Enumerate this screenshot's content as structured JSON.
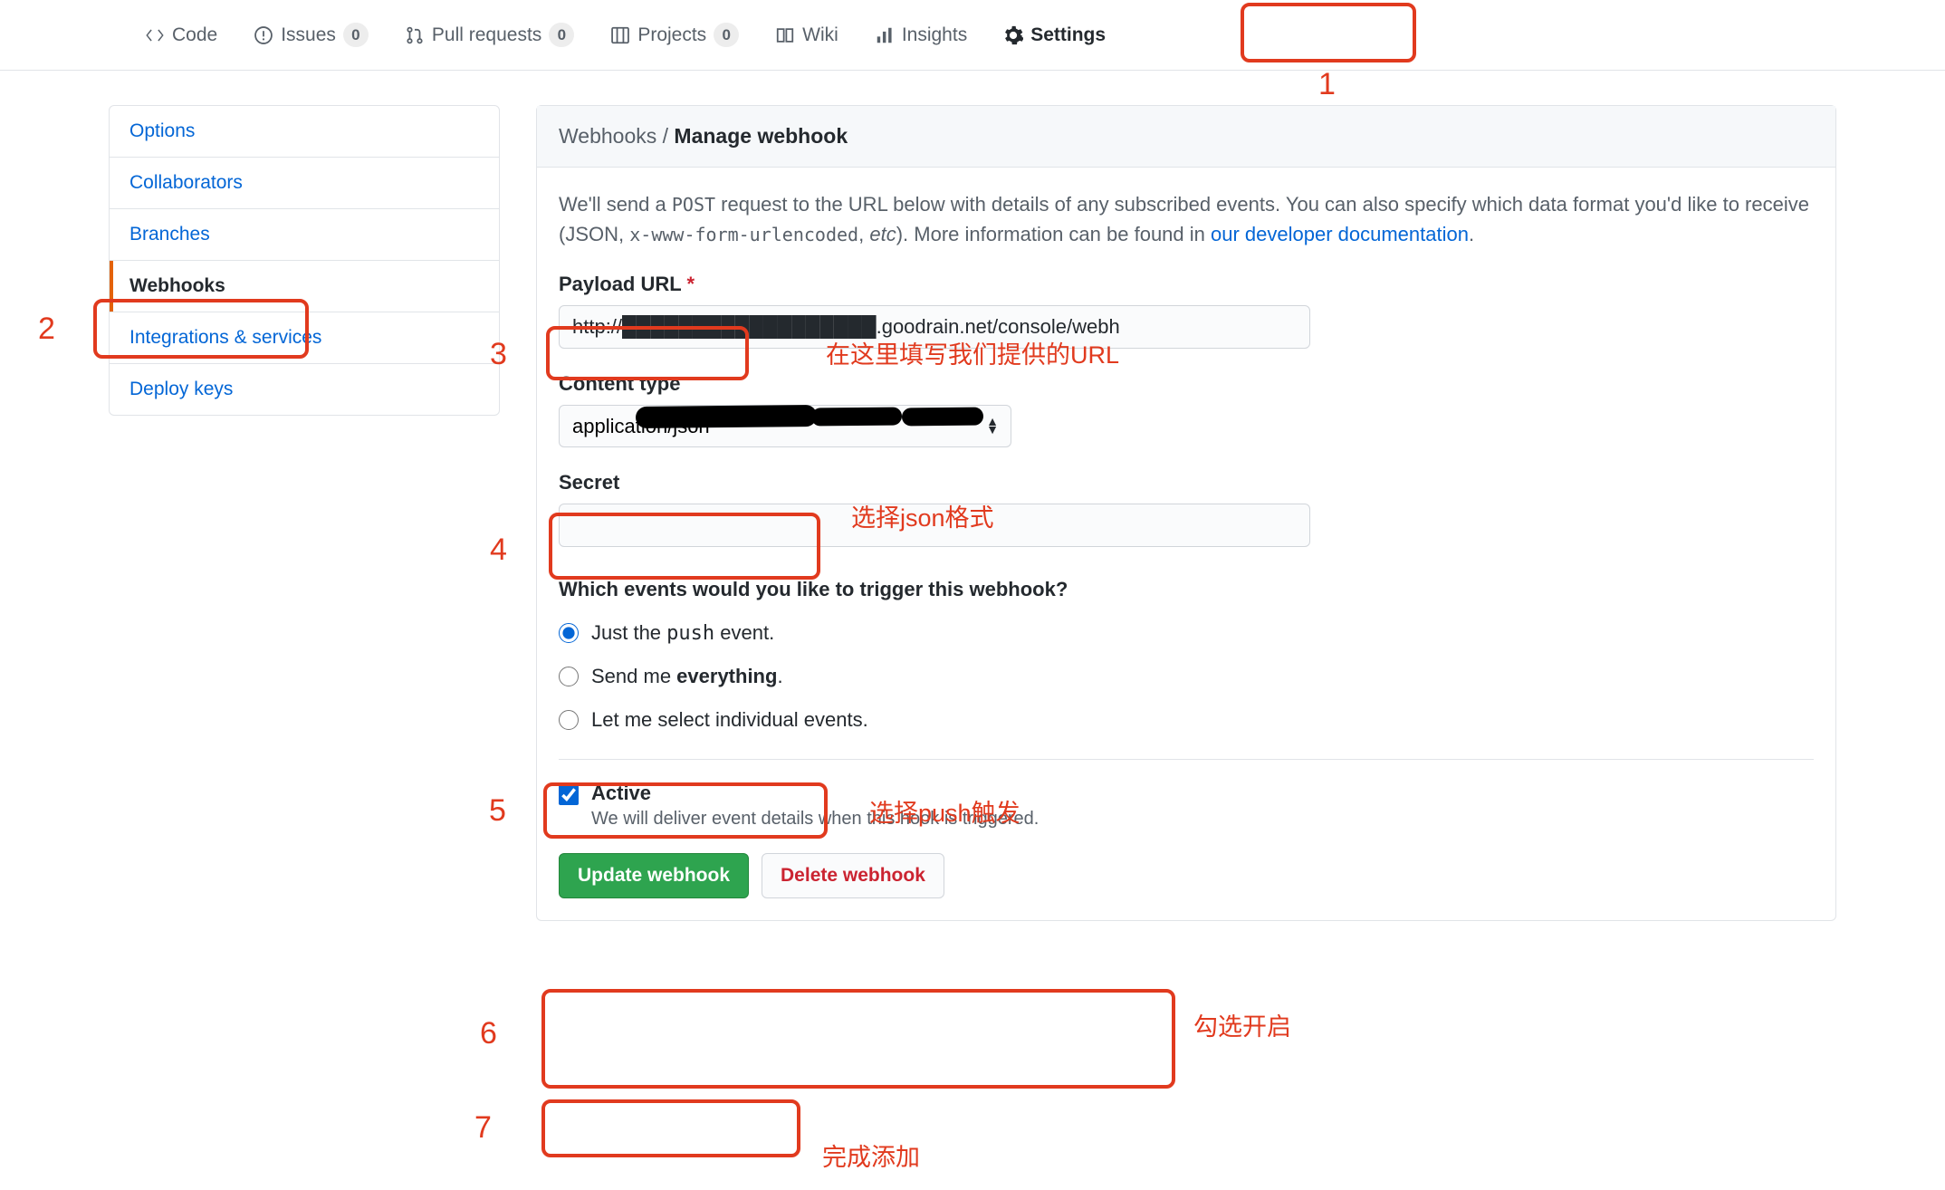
{
  "nav": {
    "code": "Code",
    "issues": "Issues",
    "issues_count": "0",
    "pulls": "Pull requests",
    "pulls_count": "0",
    "projects": "Projects",
    "projects_count": "0",
    "wiki": "Wiki",
    "insights": "Insights",
    "settings": "Settings"
  },
  "sidebar": {
    "options": "Options",
    "collaborators": "Collaborators",
    "branches": "Branches",
    "webhooks": "Webhooks",
    "integrations": "Integrations & services",
    "deploy": "Deploy keys"
  },
  "head": {
    "crumb": "Webhooks / ",
    "title": "Manage webhook"
  },
  "desc": {
    "p1a": "We'll send a ",
    "p1b": "POST",
    "p1c": " request to the URL below with details of any subscribed events. You can also specify which data format you'd like to receive (JSON, ",
    "p1d": "x-www-form-urlencoded",
    "p1e": ", ",
    "p1f": "etc",
    "p1g": "). More information can be found in ",
    "link": "our developer documentation",
    "p1h": "."
  },
  "form": {
    "payload_label": "Payload URL",
    "payload_value": "http://██████████████████.goodrain.net/console/webh",
    "content_type_label": "Content type",
    "content_type_value": "application/json",
    "secret_label": "Secret",
    "secret_value": "",
    "events_label": "Which events would you like to trigger this webhook?",
    "evt_push_a": "Just the ",
    "evt_push_b": "push",
    "evt_push_c": " event.",
    "evt_all_a": "Send me ",
    "evt_all_b": "everything",
    "evt_all_c": ".",
    "evt_sel": "Let me select individual events.",
    "active_label": "Active",
    "active_note": "We will deliver event details when this hook is triggered.",
    "btn_update": "Update webhook",
    "btn_delete": "Delete webhook"
  },
  "anno": {
    "n1": "1",
    "n2": "2",
    "n3": "3",
    "n4": "4",
    "n5": "5",
    "n6": "6",
    "n7": "7",
    "t3": "在这里填写我们提供的URL",
    "t4": "选择json格式",
    "t5": "选择push触发",
    "t6": "勾选开启",
    "t7": "完成添加"
  }
}
